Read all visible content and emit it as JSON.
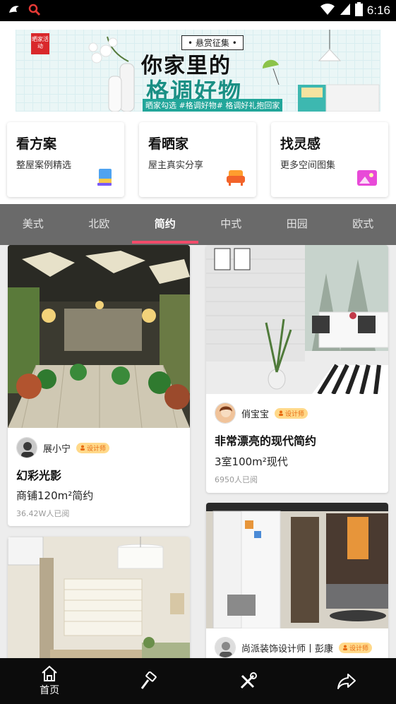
{
  "status_bar": {
    "time": "6:16"
  },
  "banner": {
    "tag": "晒家活动",
    "subtitle": "• 悬赏征集 •",
    "title_line1": "你家里的",
    "title_line2": "格调好物",
    "footer": "晒家勾选 #格调好物# 格调好礼抱回家"
  },
  "quick_links": [
    {
      "title": "看方案",
      "subtitle": "整屋案例精选"
    },
    {
      "title": "看晒家",
      "subtitle": "屋主真实分享"
    },
    {
      "title": "找灵感",
      "subtitle": "更多空间图集"
    }
  ],
  "tabs": [
    "美式",
    "北欧",
    "简约",
    "中式",
    "田园",
    "欧式"
  ],
  "active_tab": "简约",
  "badge_label": "设计师",
  "cards": [
    {
      "author": "展小宁",
      "title": "幻彩光影",
      "spec": "商铺120m²简约",
      "views": "36.42W人已阅"
    },
    {
      "author": "俏宝宝",
      "title": "非常漂亮的现代简约",
      "spec": "3室100m²现代",
      "views": "6950人已阅"
    },
    {
      "author": "尚派装饰设计师丨彭康"
    }
  ],
  "bottom_nav": {
    "home_label": "首页"
  },
  "colors": {
    "accent": "#f24b6a",
    "tabbar": "#6a6a6a",
    "badge": "#ffd98a",
    "banner_green": "#1a8f84"
  }
}
